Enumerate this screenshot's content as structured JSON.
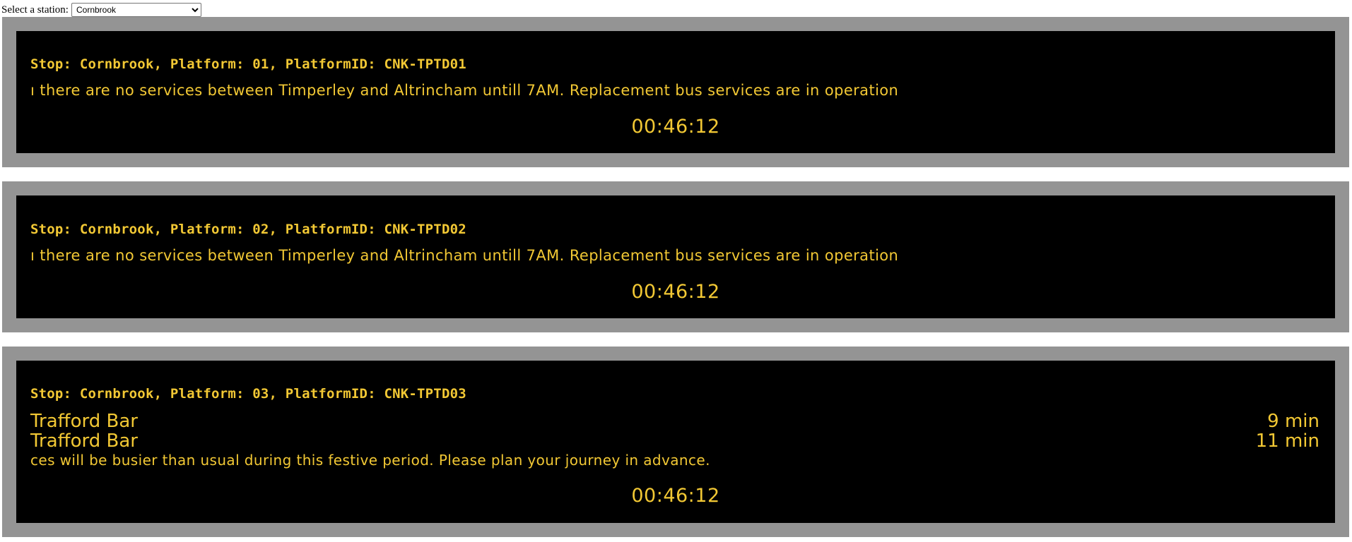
{
  "station_selector": {
    "label": "Select a station:",
    "selected": "Cornbrook"
  },
  "boards": [
    {
      "stop_line": "Stop: Cornbrook, Platform: 01, PlatformID: CNK-TPTD01",
      "message": "ı there are no services between Timperley and Altrincham untill 7AM. Replacement bus services are in operation",
      "clock": "00:46:12"
    },
    {
      "stop_line": "Stop: Cornbrook, Platform: 02, PlatformID: CNK-TPTD02",
      "message": "ı there are no services between Timperley and Altrincham untill 7AM. Replacement bus services are in operation",
      "clock": "00:46:12"
    },
    {
      "stop_line": "Stop: Cornbrook, Platform: 03, PlatformID: CNK-TPTD03",
      "departures": [
        {
          "destination": "Trafford Bar",
          "wait": "9 min"
        },
        {
          "destination": "Trafford Bar",
          "wait": "11 min"
        }
      ],
      "message": "ces will be busier than usual during this festive period. Please plan your journey in advance.",
      "clock": "00:46:12"
    }
  ],
  "colors": {
    "frame": "#949494",
    "board_background": "#000000",
    "led_text": "#f2c834"
  }
}
